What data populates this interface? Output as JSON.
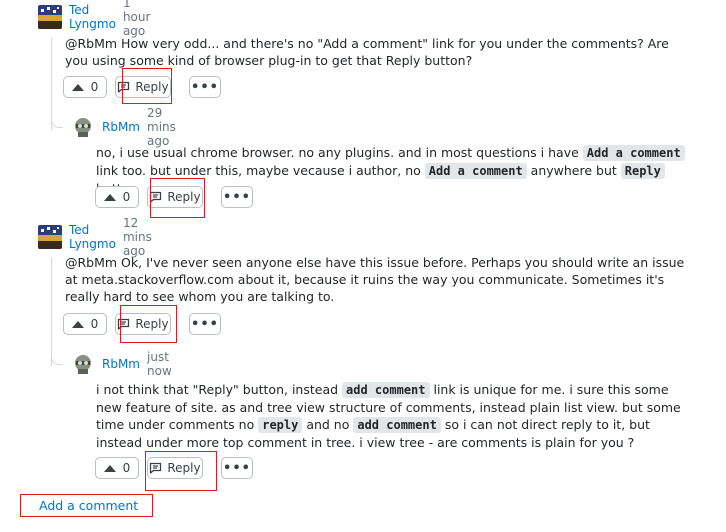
{
  "comments": [
    {
      "author": "Ted Lyngmo",
      "time": "1 hour ago",
      "text_parts": [
        "@RbMm How very odd... and there's no \"Add a comment\" link for you under the comments? Are you using some kind of browser plug-in to get that Reply button?"
      ],
      "votes": "0",
      "reply_label": "Reply",
      "more_label": "•••"
    },
    {
      "author": "RbMm",
      "time": "29 mins ago",
      "text_parts": [
        "no, i use usual chrome browser. no any plugins. and in most questions i have ",
        "Add a comment",
        " link too. but under this, maybe vecause i author, no ",
        "Add a comment",
        " anywhere but ",
        "Reply",
        " button"
      ],
      "votes": "0",
      "reply_label": "Reply",
      "more_label": "•••"
    },
    {
      "author": "Ted Lyngmo",
      "time": "12 mins ago",
      "text_parts": [
        "@RbMm Ok, I've never seen anyone else have this issue before. Perhaps you should write an issue at meta.stackoverflow.com about it, because it ruins the way you communicate. Sometimes it's really hard to see whom you are talking to."
      ],
      "votes": "0",
      "reply_label": "Reply",
      "more_label": "•••"
    },
    {
      "author": "RbMm",
      "time": "just now",
      "text_parts": [
        "i not think that \"Reply\" button, instead ",
        "add comment",
        " link is unique for me. i sure this some new feature of site. as and tree view structure of comments, instead plain list view. but some time under comments no ",
        "reply",
        " and no ",
        "add comment",
        " so i can not direct reply to it, but instead under more top comment in tree. i view tree - are comments is plain for you ?"
      ],
      "votes": "0",
      "reply_label": "Reply",
      "more_label": "•••"
    }
  ],
  "add_comment_label": "Add a comment",
  "colors": {
    "link": "#0074cc",
    "highlight_box": "#e0181f",
    "code_bg": "#e3e6e8"
  },
  "icons": {
    "vote": "upvote-triangle-icon",
    "reply": "reply-icon",
    "more": "more-dots-icon"
  }
}
